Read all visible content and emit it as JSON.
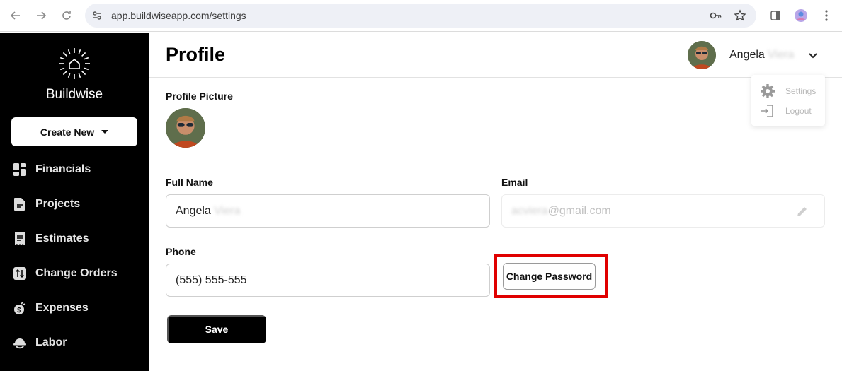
{
  "browser": {
    "url": "app.buildwiseapp.com/settings",
    "icons": [
      "back-icon",
      "forward-icon",
      "reload-icon",
      "site-info-icon",
      "key-icon",
      "star-icon",
      "sidepanel-icon",
      "profile-icon",
      "kebab-icon"
    ]
  },
  "sidebar": {
    "brand": "Buildwise",
    "create_new": "Create New",
    "items": [
      {
        "label": "Financials",
        "icon": "grid-icon"
      },
      {
        "label": "Projects",
        "icon": "document-icon"
      },
      {
        "label": "Estimates",
        "icon": "receipt-icon"
      },
      {
        "label": "Change Orders",
        "icon": "swap-icon"
      },
      {
        "label": "Expenses",
        "icon": "money-bag-icon"
      },
      {
        "label": "Labor",
        "icon": "hard-hat-icon"
      }
    ]
  },
  "header": {
    "title": "Profile",
    "user_first": "Angela",
    "user_last": "Viera"
  },
  "user_menu": {
    "items": [
      {
        "label": "Settings",
        "icon": "gear-icon"
      },
      {
        "label": "Logout",
        "icon": "logout-icon"
      }
    ]
  },
  "form": {
    "profile_picture_label": "Profile Picture",
    "full_name_label": "Full Name",
    "full_name_first": "Angela",
    "full_name_last": "Viera",
    "email_label": "Email",
    "email_local": "acviera",
    "email_domain": "@gmail.com",
    "phone_label": "Phone",
    "phone_value": "(555) 555-555",
    "change_password": "Change Password",
    "save": "Save"
  },
  "colors": {
    "sidebar_bg": "#000000",
    "highlight": "#e00000"
  }
}
